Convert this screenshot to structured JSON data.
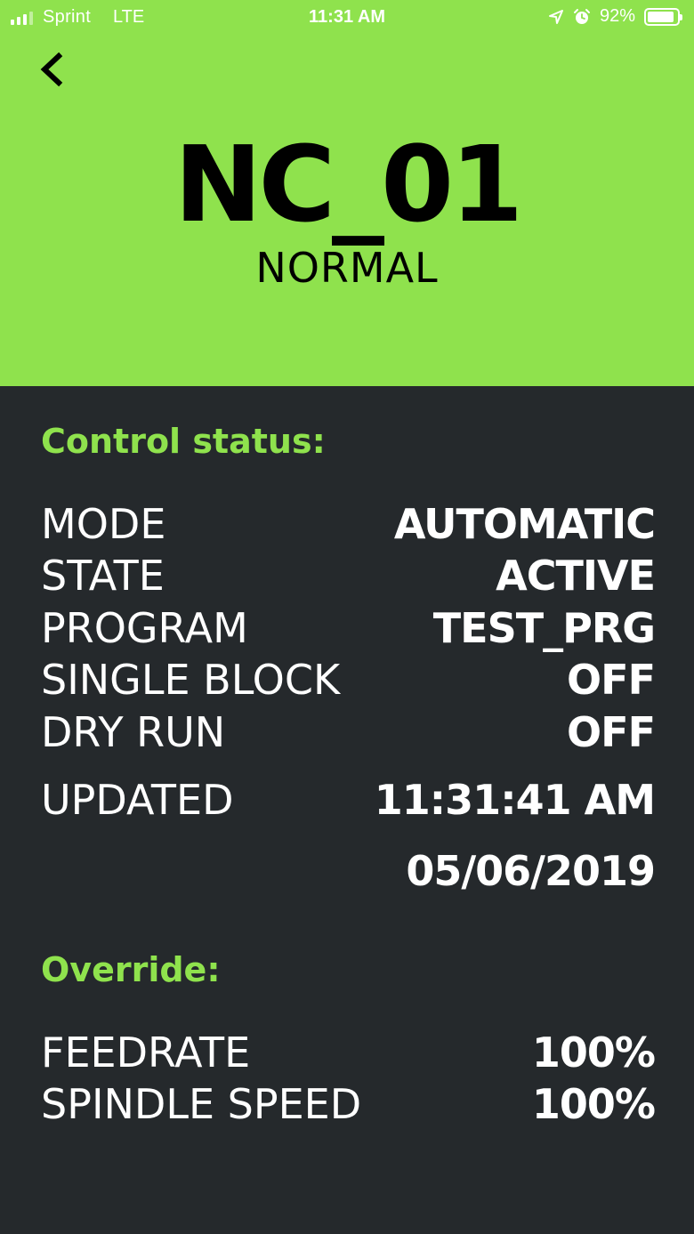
{
  "status_bar": {
    "carrier": "Sprint",
    "network": "LTE",
    "time": "11:31 AM",
    "battery": "92%",
    "battery_level": 0.92
  },
  "header": {
    "background": "#8fe24d",
    "machine_name": "NC_01",
    "machine_mode": "NORMAL"
  },
  "control_status": {
    "title": "Control status:",
    "rows": [
      {
        "label": "MODE",
        "value": "AUTOMATIC"
      },
      {
        "label": "STATE",
        "value": "ACTIVE"
      },
      {
        "label": "PROGRAM",
        "value": "TEST_PRG"
      },
      {
        "label": "SINGLE BLOCK",
        "value": "OFF"
      },
      {
        "label": "DRY RUN",
        "value": "OFF"
      }
    ],
    "updated_label": "UPDATED",
    "updated_time": "11:31:41 AM",
    "updated_date": "05/06/2019"
  },
  "override": {
    "title": "Override:",
    "rows": [
      {
        "label": "FEEDRATE",
        "value": "100%"
      },
      {
        "label": "SPINDLE SPEED",
        "value": "100%"
      }
    ]
  },
  "colors": {
    "accent": "#8fe24d",
    "background": "#25292c",
    "text": "#ffffff"
  }
}
